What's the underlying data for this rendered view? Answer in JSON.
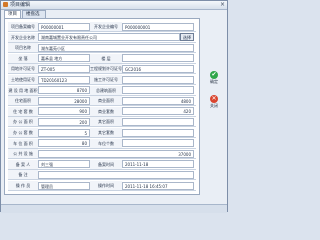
{
  "window": {
    "title": "项目编辑",
    "close": "×"
  },
  "tabs": [
    {
      "label": "项目"
    },
    {
      "label": "楼盘选择"
    }
  ],
  "rows": [
    [
      {
        "t": "lbl",
        "v": "项目备案编号"
      },
      {
        "t": "val",
        "v": "P00000001"
      },
      {
        "t": "lbl",
        "v": "开发企业编号"
      },
      {
        "t": "val",
        "v": "P000000001"
      }
    ],
    [
      {
        "t": "lbl",
        "v": "开发企业名称"
      },
      {
        "t": "val",
        "v": "湖南嘉城置业开发有限责任公司"
      },
      {
        "t": "btn",
        "v": "选择"
      }
    ],
    [
      {
        "t": "lbl",
        "v": "项目名称"
      },
      {
        "t": "val",
        "v": "湖东嘉苑小区"
      }
    ],
    [
      {
        "t": "lbl",
        "v": "坐    落"
      },
      {
        "t": "val",
        "v": "嘉禾县 地方"
      },
      {
        "t": "lbl",
        "v": "楼    层"
      },
      {
        "t": "val",
        "v": ""
      }
    ],
    [
      {
        "t": "lbl",
        "v": "用地许可证号"
      },
      {
        "t": "val",
        "v": "ZT-005"
      },
      {
        "t": "lbl",
        "v": "工程规划许可证号"
      },
      {
        "t": "val",
        "v": "GC2016"
      }
    ],
    [
      {
        "t": "lbl",
        "v": "土地使用证号"
      },
      {
        "t": "val",
        "v": "TD20160123"
      },
      {
        "t": "lbl",
        "v": "施工许可证号"
      },
      {
        "t": "val",
        "v": ""
      }
    ],
    [
      {
        "t": "lbl",
        "v": "建 设 用 地 面积"
      },
      {
        "t": "val",
        "v": "8700",
        "r": true
      },
      {
        "t": "lbl",
        "v": "总建筑面积"
      },
      {
        "t": "val",
        "v": "",
        "r": true
      }
    ],
    [
      {
        "t": "lbl",
        "v": "住宅面积"
      },
      {
        "t": "val",
        "v": "28000",
        "r": true
      },
      {
        "t": "lbl",
        "v": "商业面积"
      },
      {
        "t": "val",
        "v": "4800",
        "r": true
      }
    ],
    [
      {
        "t": "lbl",
        "v": "住 宅 套 数"
      },
      {
        "t": "val",
        "v": "900",
        "r": true
      },
      {
        "t": "lbl",
        "v": "商业套数"
      },
      {
        "t": "val",
        "v": "420",
        "r": true
      }
    ],
    [
      {
        "t": "lbl",
        "v": "办 公 面 积"
      },
      {
        "t": "val",
        "v": "200",
        "r": true
      },
      {
        "t": "lbl",
        "v": "其它面积"
      },
      {
        "t": "val",
        "v": "",
        "r": true
      }
    ],
    [
      {
        "t": "lbl",
        "v": "办 公 套 数"
      },
      {
        "t": "val",
        "v": "5",
        "r": true
      },
      {
        "t": "lbl",
        "v": "其它套数"
      },
      {
        "t": "val",
        "v": "",
        "r": true
      }
    ],
    [
      {
        "t": "lbl",
        "v": "车 位 面 积"
      },
      {
        "t": "val",
        "v": "80",
        "r": true
      },
      {
        "t": "lbl",
        "v": "车位个数"
      },
      {
        "t": "val",
        "v": "",
        "r": true
      }
    ],
    [
      {
        "t": "lbl",
        "v": "公 共 设 施"
      },
      {
        "t": "val",
        "v": "37000",
        "r": true
      }
    ],
    [
      {
        "t": "lbl",
        "v": "备  案 人"
      },
      {
        "t": "val",
        "v": "刘三强"
      },
      {
        "t": "lbl",
        "v": "备案时间"
      },
      {
        "t": "val",
        "v": "2011-11-18"
      }
    ],
    [
      {
        "t": "lbl",
        "v": "备    注"
      },
      {
        "t": "val",
        "v": ""
      }
    ],
    [
      {
        "t": "lbl",
        "v": "操 作 员"
      },
      {
        "t": "val",
        "v": "管理员"
      },
      {
        "t": "lbl",
        "v": "操作时间"
      },
      {
        "t": "val",
        "v": "2011-11-18 16:45:07"
      }
    ]
  ],
  "side": {
    "ok": "确定",
    "close": "关闭"
  }
}
